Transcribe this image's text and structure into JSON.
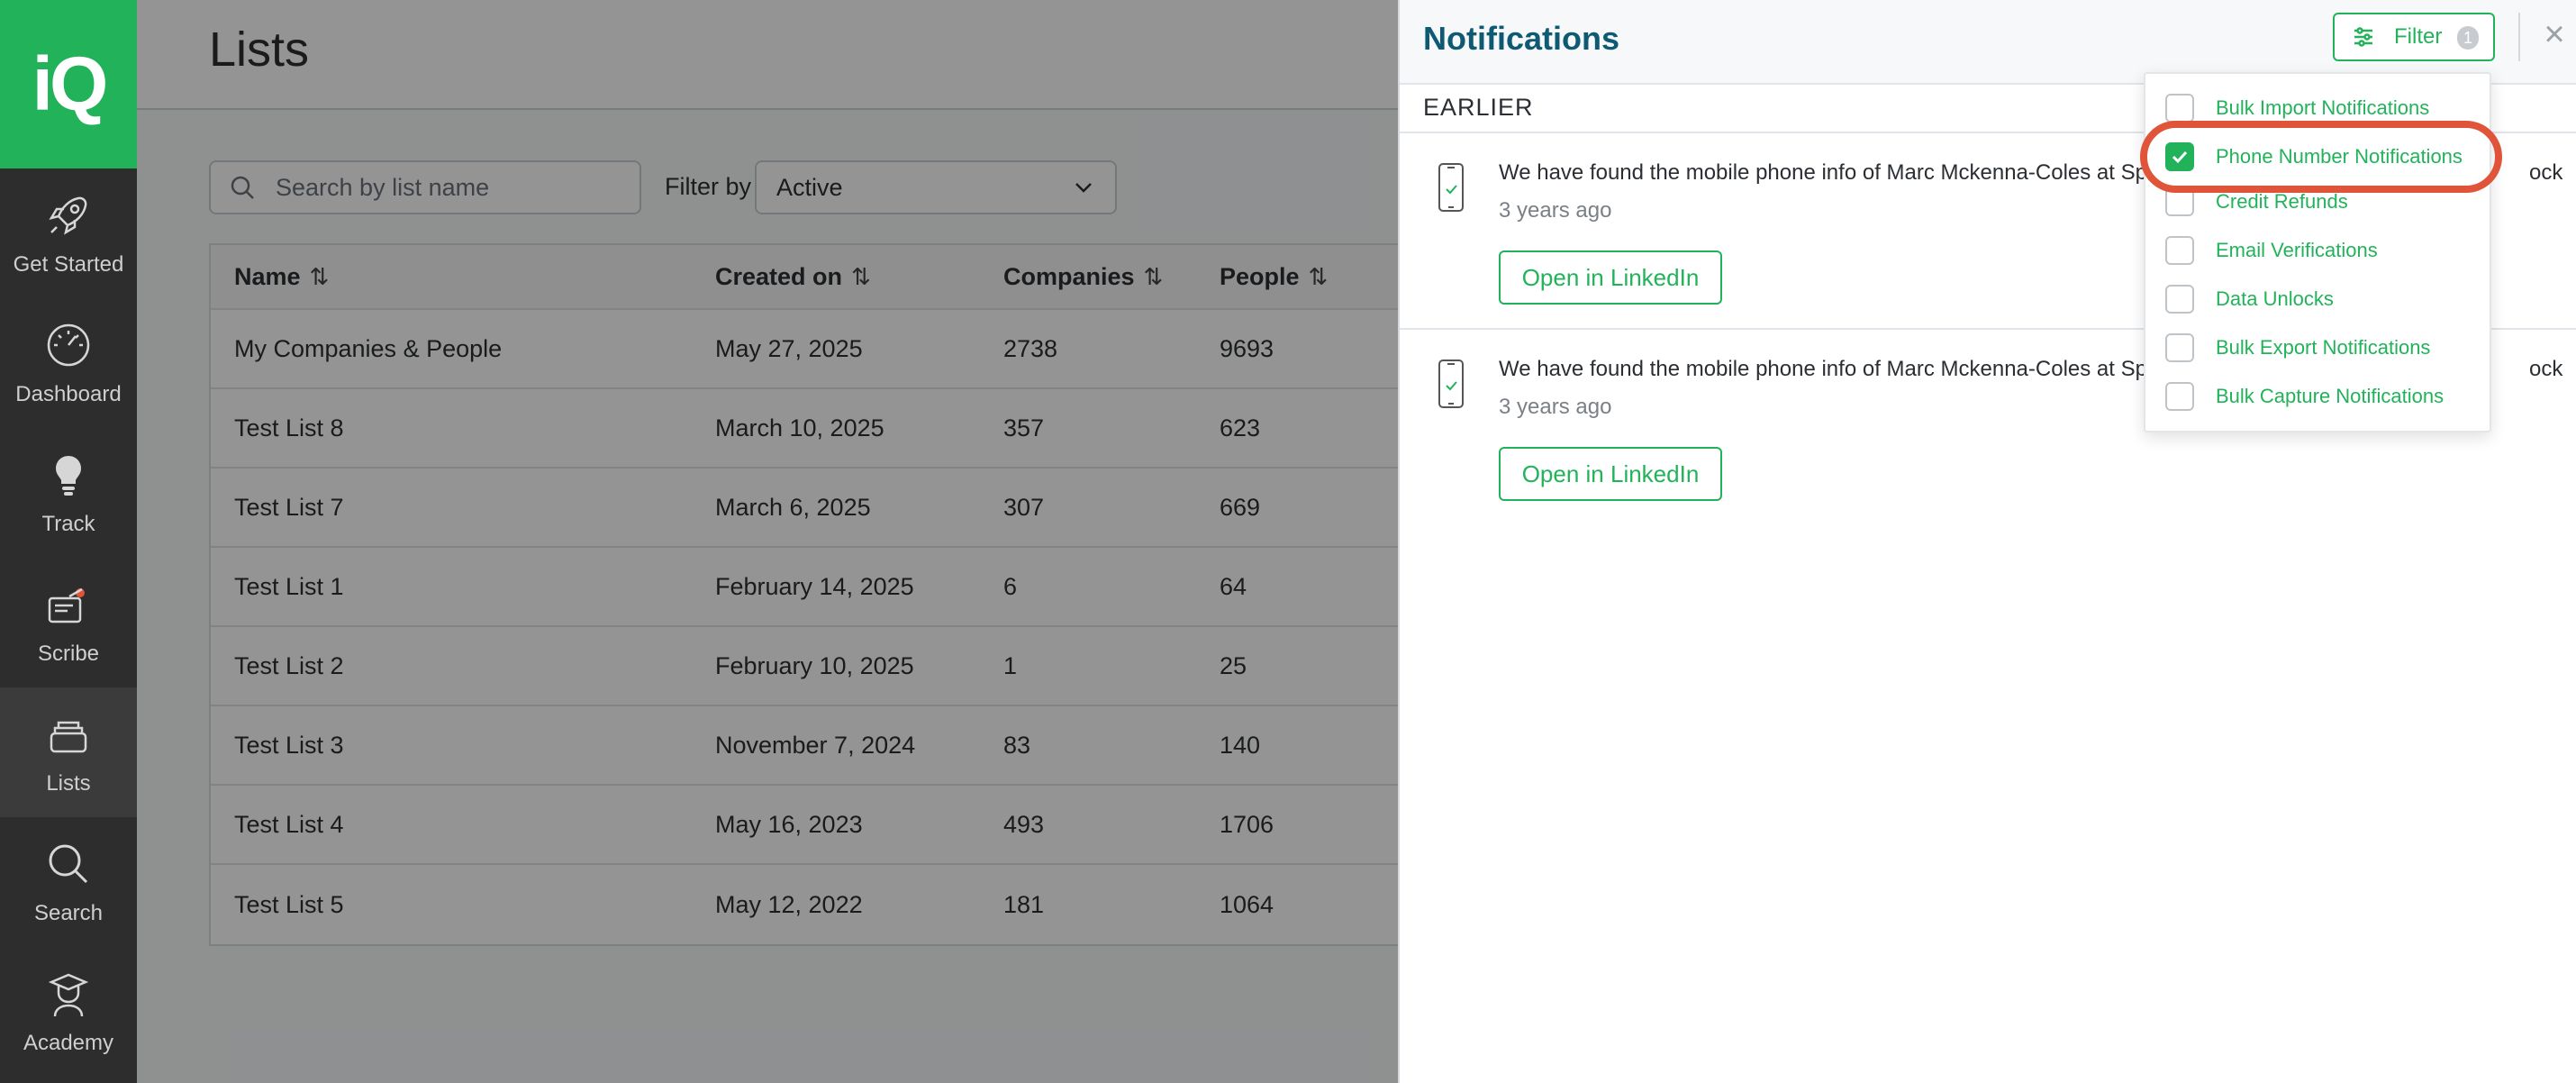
{
  "app": {
    "logo_text": "iQ",
    "brand_color": "#22b35a"
  },
  "sidebar": {
    "items": [
      {
        "label": "Get Started",
        "icon": "rocket-icon"
      },
      {
        "label": "Dashboard",
        "icon": "speedometer-icon"
      },
      {
        "label": "Track",
        "icon": "lightbulb-icon"
      },
      {
        "label": "Scribe",
        "icon": "scribe-icon"
      },
      {
        "label": "Lists",
        "icon": "stack-icon",
        "active": true
      },
      {
        "label": "Search",
        "icon": "search-icon"
      },
      {
        "label": "Academy",
        "icon": "graduate-icon"
      }
    ]
  },
  "main": {
    "title": "Lists",
    "search": {
      "placeholder": "Search by list name",
      "value": ""
    },
    "filter": {
      "label": "Filter by",
      "selected": "Active"
    },
    "table": {
      "columns": [
        "Name",
        "Created on",
        "Companies",
        "People"
      ],
      "rows": [
        {
          "name": "My Companies & People",
          "created": "May 27, 2025",
          "companies": "2738",
          "people": "9693"
        },
        {
          "name": "Test List 8",
          "created": "March 10, 2025",
          "companies": "357",
          "people": "623"
        },
        {
          "name": "Test List 7",
          "created": "March 6, 2025",
          "companies": "307",
          "people": "669"
        },
        {
          "name": "Test List 1",
          "created": "February 14, 2025",
          "companies": "6",
          "people": "64"
        },
        {
          "name": "Test List 2",
          "created": "February 10, 2025",
          "companies": "1",
          "people": "25"
        },
        {
          "name": "Test List 3",
          "created": "November 7, 2024",
          "companies": "83",
          "people": "140"
        },
        {
          "name": "Test List 4",
          "created": "May 16, 2023",
          "companies": "493",
          "people": "1706"
        },
        {
          "name": "Test List 5",
          "created": "May 12, 2022",
          "companies": "181",
          "people": "1064"
        }
      ]
    }
  },
  "notifications": {
    "title": "Notifications",
    "filter_label": "Filter",
    "filter_count": "1",
    "close": "×",
    "section": "EARLIER",
    "items": [
      {
        "message": "We have found the mobile phone info of Marc Mckenna-Coles at Spe",
        "time": "3 years ago",
        "action": "Open in LinkedIn"
      },
      {
        "message": "We have found the mobile phone info of Marc Mckenna-Coles at Spe",
        "time": "3 years ago",
        "action": "Open in LinkedIn"
      }
    ],
    "message_tail": "ock"
  },
  "filter_dropdown": {
    "options": [
      {
        "label": "Bulk Import Notifications",
        "checked": false
      },
      {
        "label": "Phone Number Notifications",
        "checked": true
      },
      {
        "label": "Credit Refunds",
        "checked": false
      },
      {
        "label": "Email Verifications",
        "checked": false
      },
      {
        "label": "Data Unlocks",
        "checked": false
      },
      {
        "label": "Bulk Export Notifications",
        "checked": false
      },
      {
        "label": "Bulk Capture Notifications",
        "checked": false
      }
    ]
  }
}
